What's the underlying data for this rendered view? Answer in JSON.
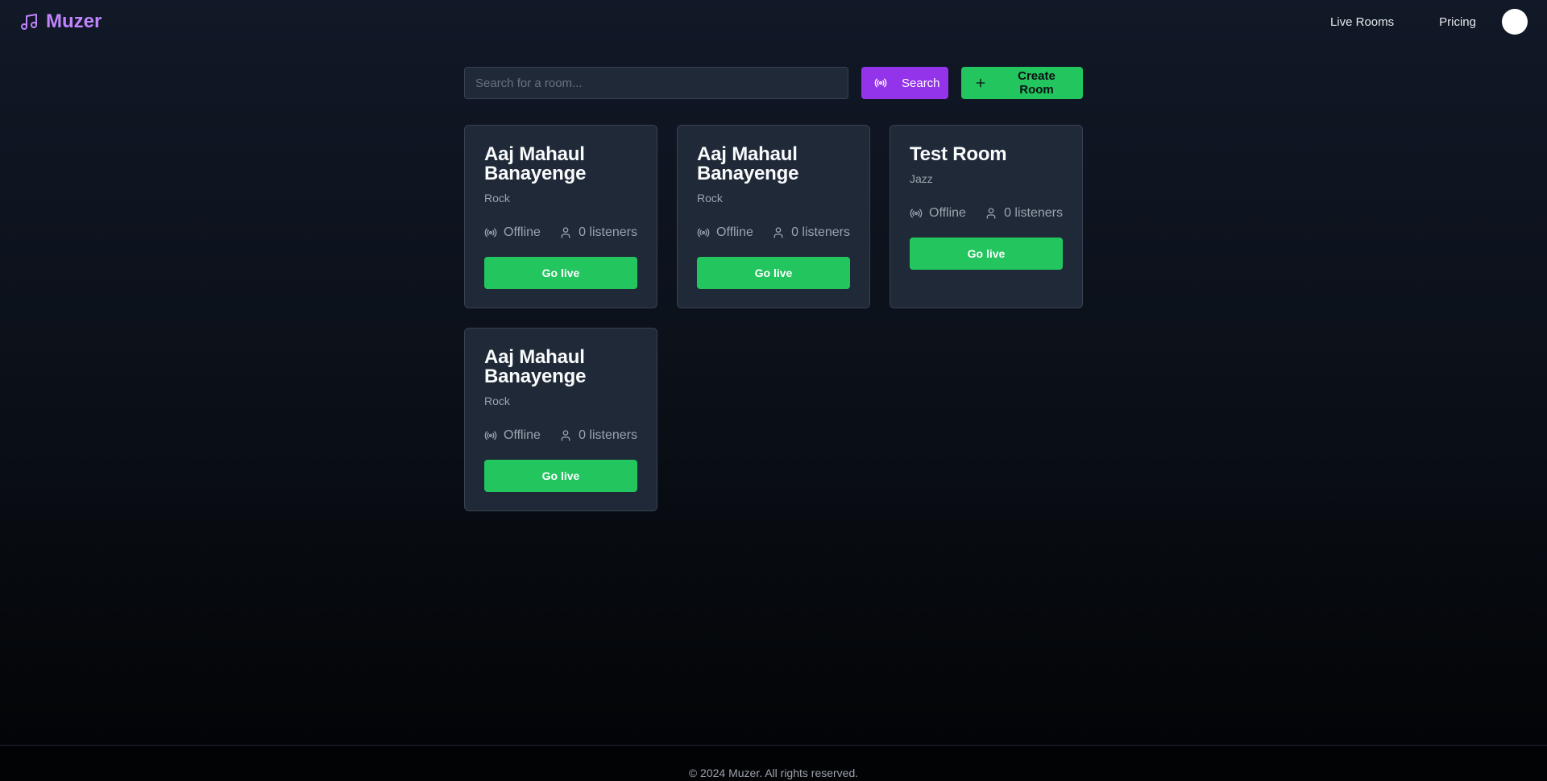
{
  "header": {
    "brand_name": "Muzer",
    "brand_icon": "music-note-icon",
    "brand_color": "#c084fc",
    "nav": [
      {
        "label": "Live Rooms"
      },
      {
        "label": "Pricing"
      }
    ]
  },
  "search": {
    "placeholder": "Search for a room...",
    "value": "",
    "search_label": "Search",
    "create_label": "Create Room"
  },
  "rooms": [
    {
      "title": "Aaj Mahaul Banayenge",
      "genre": "Rock",
      "status": "Offline",
      "listeners": "0 listeners",
      "action": "Go live"
    },
    {
      "title": "Aaj Mahaul Banayenge",
      "genre": "Rock",
      "status": "Offline",
      "listeners": "0 listeners",
      "action": "Go live"
    },
    {
      "title": "Test Room",
      "genre": "Jazz",
      "status": "Offline",
      "listeners": "0 listeners",
      "action": "Go live"
    },
    {
      "title": "Aaj Mahaul Banayenge",
      "genre": "Rock",
      "status": "Offline",
      "listeners": "0 listeners",
      "action": "Go live"
    }
  ],
  "footer": {
    "text": "© 2024 Muzer. All rights reserved."
  },
  "colors": {
    "accent_purple": "#9333ea",
    "accent_green": "#22c55e",
    "card_bg": "#1f2937"
  }
}
